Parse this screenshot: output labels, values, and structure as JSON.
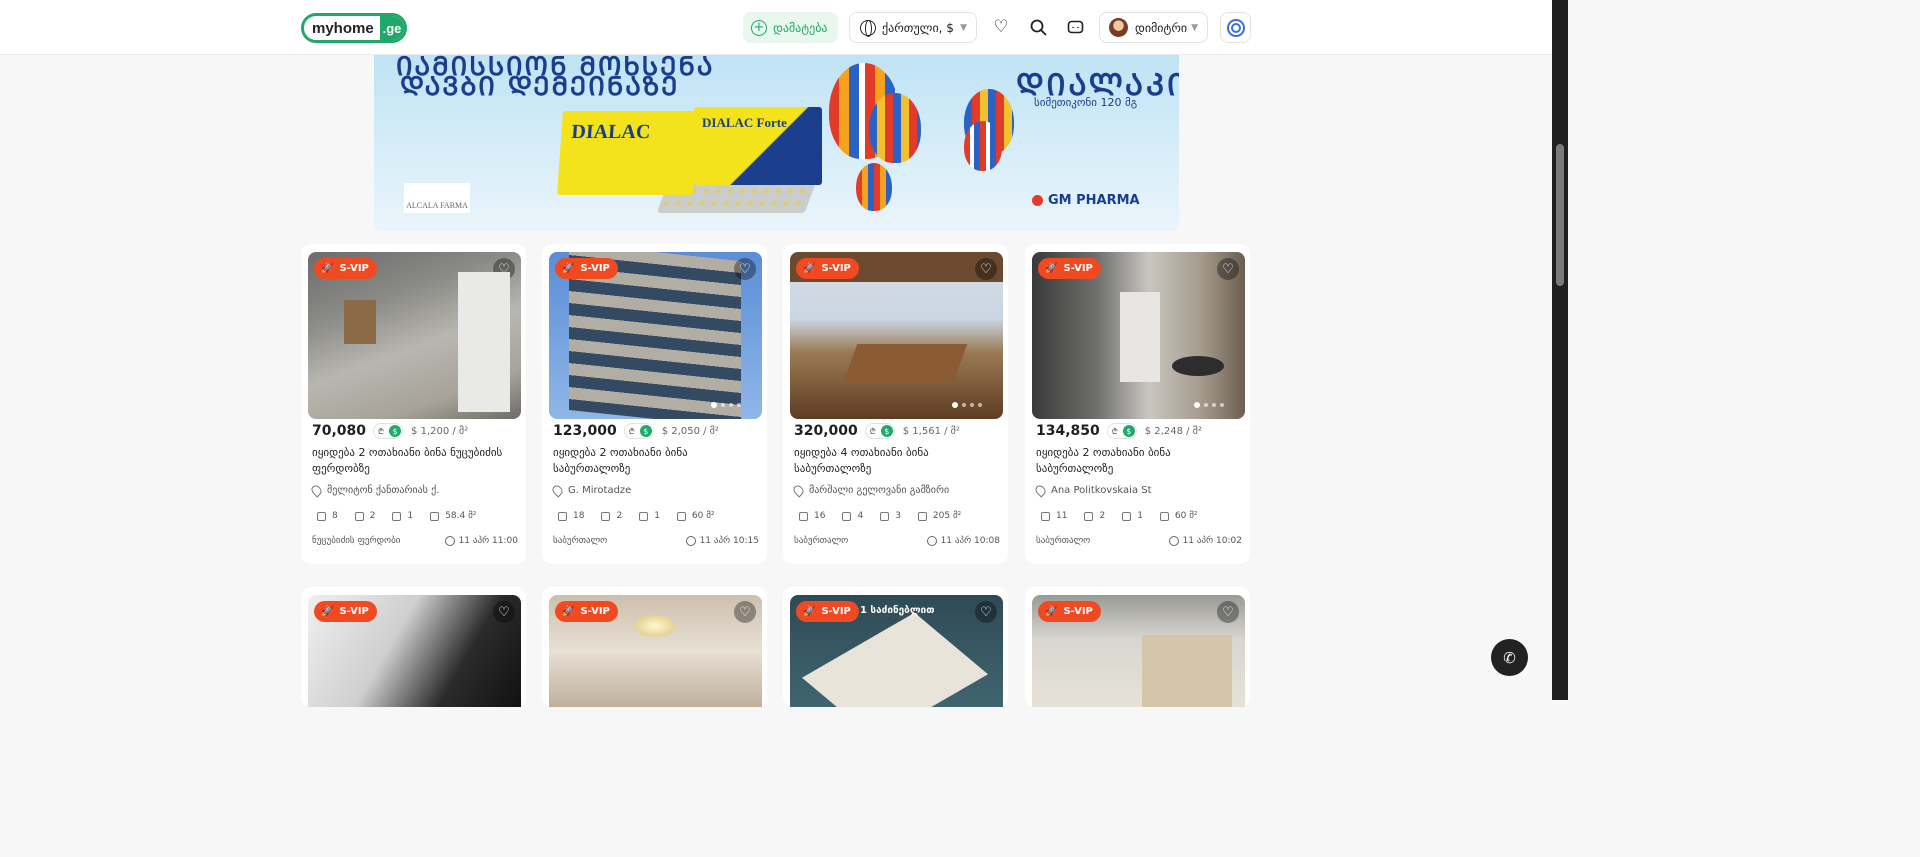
{
  "header": {
    "logo_main": "myhome",
    "logo_domain": ".ge",
    "add_label": "დამატება",
    "lang_label": "ქართული, $",
    "user_name": "დიმიტრი"
  },
  "banner": {
    "alcala": "ALCALA FARMA",
    "box1": "DIALAC",
    "box2": "DIALAC Forte",
    "gm": "GM PHARMA",
    "sub": "სიმეთიკონი 120 მგ"
  },
  "listings": [
    {
      "badge": "S-VIP",
      "price": "70,080",
      "currency_gel": "₾",
      "currency_usd": "$",
      "sqm_price": "$  1,200 / მ²",
      "title": "იყიდება 2 ოთახიანი ბინა ნუცუბიძის ფერდობზე",
      "address": "მელიტონ ქანთარიას ქ.",
      "floor": "8",
      "rooms": "2",
      "bedrooms": "1",
      "area": "58.4 მ²",
      "district": "ნუცუბიძის ფერდობი",
      "time": "11 აპრ 11:00"
    },
    {
      "badge": "S-VIP",
      "price": "123,000",
      "currency_gel": "₾",
      "currency_usd": "$",
      "sqm_price": "$  2,050 / მ²",
      "title": "იყიდება 2 ოთახიანი ბინა საბურთალოზე",
      "address": "G. Mirotadze",
      "floor": "18",
      "rooms": "2",
      "bedrooms": "1",
      "area": "60 მ²",
      "district": "საბურთალო",
      "time": "11 აპრ 10:15"
    },
    {
      "badge": "S-VIP",
      "price": "320,000",
      "currency_gel": "₾",
      "currency_usd": "$",
      "sqm_price": "$  1,561 / მ²",
      "title": "იყიდება 4 ოთახიანი ბინა საბურთალოზე",
      "address": "მარშალი გელოვანი გამზირი",
      "floor": "16",
      "rooms": "4",
      "bedrooms": "3",
      "area": "205 მ²",
      "district": "საბურთალო",
      "time": "11 აპრ 10:08"
    },
    {
      "badge": "S-VIP",
      "price": "134,850",
      "currency_gel": "₾",
      "currency_usd": "$",
      "sqm_price": "$  2,248 / მ²",
      "title": "იყიდება 2 ოთახიანი ბინა საბურთალოზე",
      "address": "Ana Politkovskaia St",
      "floor": "11",
      "rooms": "2",
      "bedrooms": "1",
      "area": "60 მ²",
      "district": "საბურთალო",
      "time": "11 აპრ 10:02"
    }
  ],
  "listings_row2": [
    {
      "badge": "S-VIP"
    },
    {
      "badge": "S-VIP"
    },
    {
      "badge": "S-VIP",
      "overlay_text": "ბინა 1 საძინებლით"
    },
    {
      "badge": "S-VIP"
    }
  ],
  "icons": {
    "favorite": "heart-icon",
    "search": "search-icon",
    "messages": "chat-icon",
    "globe": "globe-icon",
    "phone": "phone-icon"
  },
  "colors": {
    "brand_green": "#21a86a",
    "svip_red": "#f04a23"
  }
}
